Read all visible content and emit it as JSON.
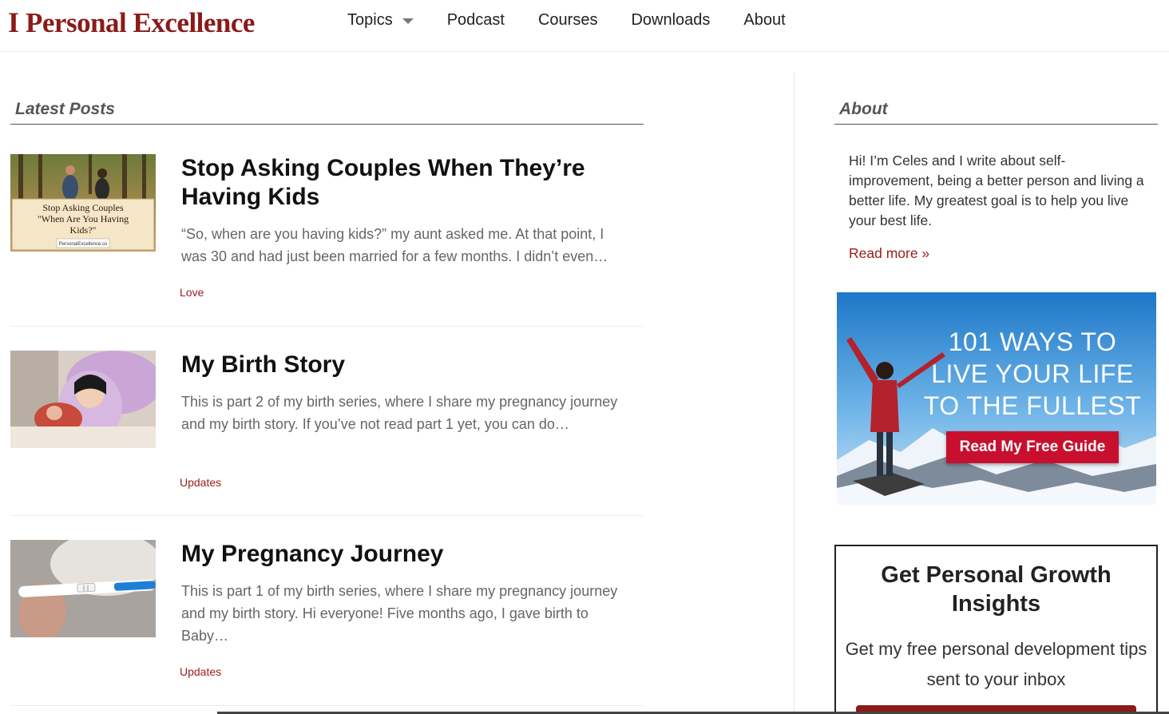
{
  "header": {
    "logo_mark": "I",
    "logo_text": "Personal Excellence",
    "nav": [
      {
        "label": "Topics",
        "has_dropdown": true
      },
      {
        "label": "Podcast"
      },
      {
        "label": "Courses"
      },
      {
        "label": "Downloads"
      },
      {
        "label": "About"
      }
    ]
  },
  "main": {
    "heading": "Latest Posts",
    "posts": [
      {
        "title": "Stop Asking Couples When They’re Having Kids",
        "excerpt": "“So, when are you having kids?” my aunt asked me. At that point, I was 30 and had just been married for a few months. I didn’t even…",
        "category": "Love",
        "thumb_caption_1": "Stop Asking Couples",
        "thumb_caption_2": "\"When Are You Having",
        "thumb_caption_3": "Kids?\"",
        "thumb_caption_4": "PersonalExcellence.co"
      },
      {
        "title": "My Birth Story",
        "excerpt": "This is part 2 of my birth series, where I share my pregnancy journey and my birth story. If you’ve not read part 1 yet, you can do…",
        "category": "Updates"
      },
      {
        "title": "My Pregnancy Journey",
        "excerpt": "This is part 1 of my birth series, where I share my pregnancy journey and my birth story. Hi everyone! Five months ago, I gave birth to Baby…",
        "category": "Updates"
      }
    ]
  },
  "sidebar": {
    "heading": "About",
    "about_text": "Hi! I’m Celes and I write about self-improvement, being a better person and living a better life. My greatest goal is to help you live your best life.",
    "read_more": "Read more »",
    "promo": {
      "line_1": "101 WAYS TO",
      "line_2": "LIVE YOUR LIFE",
      "line_3": "TO THE FULLEST",
      "button": "Read My Free Guide"
    },
    "optin": {
      "title": "Get Personal Growth Insights",
      "subtitle": "Get my free personal development tips sent to your inbox"
    }
  },
  "colors": {
    "brand": "#8b1a1a",
    "category": "#9b1b1b",
    "promo_button": "#c8102e"
  }
}
